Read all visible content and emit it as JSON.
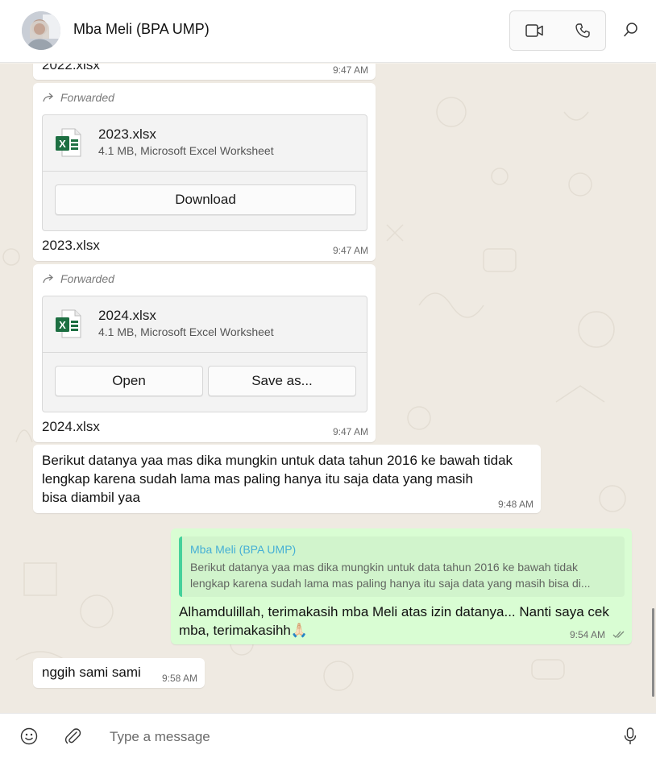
{
  "header": {
    "title": "Mba Meli (BPA UMP)",
    "video_icon": "video-camera-icon",
    "call_icon": "phone-icon",
    "search_icon": "search-icon"
  },
  "messages": {
    "m1": {
      "caption": "2022.xlsx",
      "time": "9:47 AM"
    },
    "m2": {
      "forwarded": "Forwarded",
      "file_name": "2023.xlsx",
      "file_meta": "4.1 MB, Microsoft Excel Worksheet",
      "button": "Download",
      "caption": "2023.xlsx",
      "time": "9:47 AM"
    },
    "m3": {
      "forwarded": "Forwarded",
      "file_name": "2024.xlsx",
      "file_meta": "4.1 MB, Microsoft Excel Worksheet",
      "open_button": "Open",
      "save_button": "Save as...",
      "caption": "2024.xlsx",
      "time": "9:47 AM"
    },
    "m4": {
      "line1": "Berikut datanya yaa mas dika mungkin untuk data tahun 2016 ke bawah tidak",
      "line2": "lengkap karena sudah lama mas paling hanya itu saja data yang masih",
      "line3": "bisa diambil yaa",
      "time": "9:48 AM"
    },
    "m5": {
      "quote_name": "Mba Meli (BPA UMP)",
      "quote_line1": "Berikut datanya yaa mas dika mungkin untuk data tahun 2016 ke bawah tidak",
      "quote_line2": "lengkap karena sudah lama mas paling hanya itu saja data yang masih bisa di...",
      "line1": "Alhamdulillah, terimakasih mba Meli atas izin datanya... Nanti saya cek",
      "line2": "mba, terimakasihh",
      "emoji": "🙏🏻",
      "time": "9:54 AM",
      "status_icon": "double-check-icon"
    },
    "m6": {
      "text": "nggih sami sami",
      "time": "9:58 AM"
    }
  },
  "compose": {
    "placeholder": "Type a message",
    "emoji_icon": "emoji-icon",
    "attach_icon": "paperclip-icon",
    "mic_icon": "microphone-icon"
  },
  "colors": {
    "outgoing_bubble": "#d9fdd3",
    "incoming_bubble": "#ffffff",
    "quote_accent": "#35cd96",
    "quote_name": "#35a7d6",
    "excel_green": "#1d6f42"
  }
}
